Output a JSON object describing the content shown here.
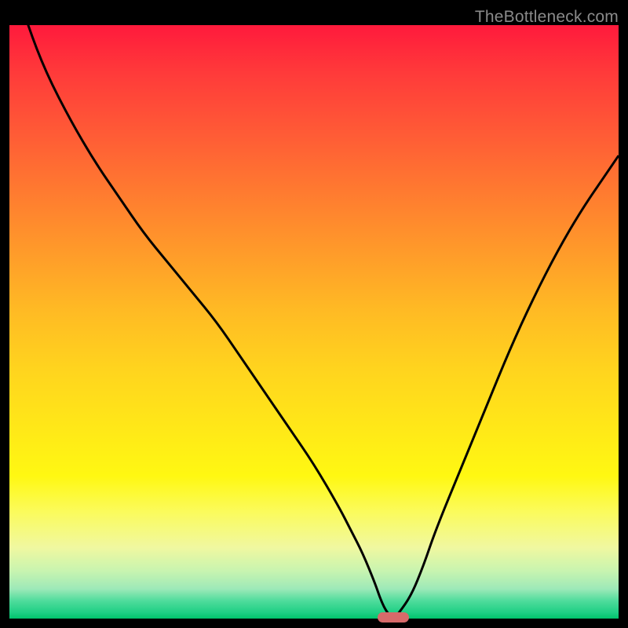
{
  "attribution": "TheBottleneck.com",
  "colors": {
    "frame": "#000000",
    "curve": "#000000",
    "marker": "#d86a6a"
  },
  "chart_data": {
    "type": "line",
    "title": "",
    "xlabel": "",
    "ylabel": "",
    "xlim": [
      0,
      100
    ],
    "ylim": [
      0,
      100
    ],
    "x": [
      0,
      3,
      6,
      10,
      14,
      18,
      22,
      26,
      30,
      34,
      38,
      42,
      46,
      50,
      54,
      56,
      58,
      60,
      61,
      62,
      63,
      64,
      66,
      68,
      70,
      74,
      78,
      82,
      86,
      90,
      94,
      98,
      100
    ],
    "values": [
      110,
      100,
      92,
      84,
      77,
      71,
      65,
      60,
      55,
      50,
      44,
      38,
      32,
      26,
      19,
      15,
      11,
      6,
      3,
      1,
      0,
      1,
      4,
      9,
      15,
      25,
      35,
      45,
      54,
      62,
      69,
      75,
      78
    ],
    "optimum": {
      "x": 63,
      "y": 0
    },
    "note": "Values approximate the vertical position of the black curve as a percent of the plot height (0 = bottom, 100 = top). The curve exceeds the top edge near x=0."
  }
}
